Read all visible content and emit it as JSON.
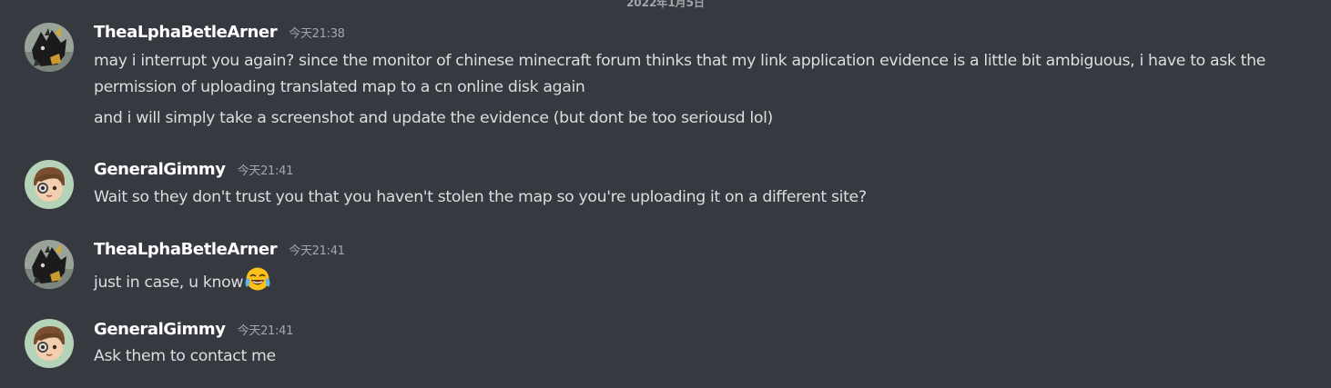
{
  "date_divider": "2022年1月5日",
  "messages": [
    {
      "author": "TheaLphaBetleArner",
      "avatar": "black-fox-avatar",
      "time": "今天21:38",
      "lines": [
        "may i interrupt you again? since the monitor of chinese minecraft forum thinks that my link application evidence is a little bit ambiguous, i have to ask the",
        "permission of uploading translated map to a cn online disk again",
        "and i will simply take a screenshot and update the evidence (but dont be too seriousd lol)"
      ]
    },
    {
      "author": "GeneralGimmy",
      "avatar": "cartoon-boy-avatar",
      "time": "今天21:41",
      "lines": [
        "Wait so they don't trust you that you haven't stolen the map so you're uploading it on a different site?"
      ]
    },
    {
      "author": "TheaLphaBetleArner",
      "avatar": "black-fox-avatar",
      "time": "今天21:41",
      "lines": [
        "just in case, u know"
      ],
      "emoji": "face-with-tears-of-joy"
    },
    {
      "author": "GeneralGimmy",
      "avatar": "cartoon-boy-avatar",
      "time": "今天21:41",
      "lines": [
        "Ask them to contact me"
      ]
    }
  ],
  "colors": {
    "background": "#36393f",
    "username": "#ffffff",
    "message_text": "#dcddde",
    "timestamp": "#a3a6aa",
    "avatar_green_bg": "#b5d3b8"
  }
}
